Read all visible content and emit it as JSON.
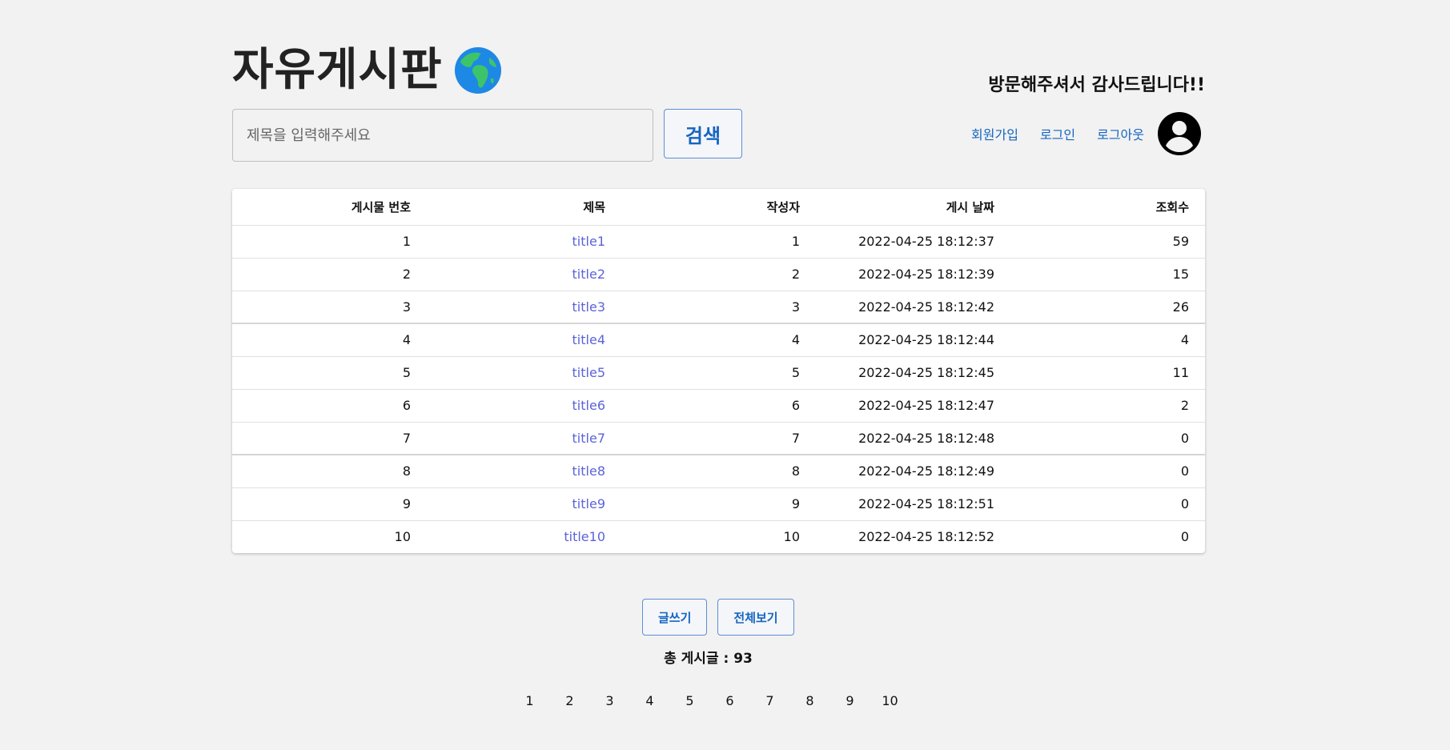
{
  "header": {
    "title": "자유게시판",
    "welcome": "방문해주셔서 감사드립니다!!"
  },
  "search": {
    "placeholder": "제목을 입력해주세요",
    "value": "",
    "button_label": "검색"
  },
  "nav": {
    "signup": "회원가입",
    "login": "로그인",
    "logout": "로그아웃"
  },
  "icons": {
    "globe": "globe-icon",
    "avatar": "account-circle-icon"
  },
  "table": {
    "headers": [
      "게시물 번호",
      "제목",
      "작성자",
      "게시 날짜",
      "조회수"
    ],
    "rows": [
      {
        "no": "1",
        "title": "title1",
        "author": "1",
        "date": "2022-04-25 18:12:37",
        "views": "59"
      },
      {
        "no": "2",
        "title": "title2",
        "author": "2",
        "date": "2022-04-25 18:12:39",
        "views": "15"
      },
      {
        "no": "3",
        "title": "title3",
        "author": "3",
        "date": "2022-04-25 18:12:42",
        "views": "26"
      },
      {
        "no": "4",
        "title": "title4",
        "author": "4",
        "date": "2022-04-25 18:12:44",
        "views": "4"
      },
      {
        "no": "5",
        "title": "title5",
        "author": "5",
        "date": "2022-04-25 18:12:45",
        "views": "11"
      },
      {
        "no": "6",
        "title": "title6",
        "author": "6",
        "date": "2022-04-25 18:12:47",
        "views": "2"
      },
      {
        "no": "7",
        "title": "title7",
        "author": "7",
        "date": "2022-04-25 18:12:48",
        "views": "0"
      },
      {
        "no": "8",
        "title": "title8",
        "author": "8",
        "date": "2022-04-25 18:12:49",
        "views": "0"
      },
      {
        "no": "9",
        "title": "title9",
        "author": "9",
        "date": "2022-04-25 18:12:51",
        "views": "0"
      },
      {
        "no": "10",
        "title": "title10",
        "author": "10",
        "date": "2022-04-25 18:12:52",
        "views": "0"
      }
    ]
  },
  "actions": {
    "write": "글쓰기",
    "view_all": "전체보기"
  },
  "total": "총 게시글 : 93",
  "pagination": [
    "1",
    "2",
    "3",
    "4",
    "5",
    "6",
    "7",
    "8",
    "9",
    "10"
  ],
  "colors": {
    "background": "#f2f2f2",
    "link_blue": "#1565c0",
    "title_link": "#5b63d9"
  }
}
